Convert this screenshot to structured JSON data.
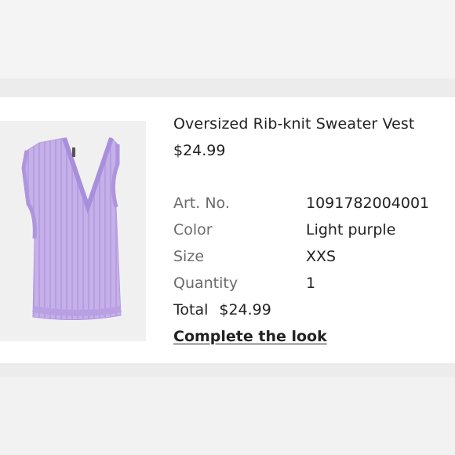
{
  "product": {
    "name": "Oversized Rib-knit Sweater Vest",
    "price": "$24.99",
    "image_icon": "sweater-vest-image",
    "color_swatch": "#c7b2ec"
  },
  "details": [
    {
      "label": "Art. No.",
      "value": "1091782004001"
    },
    {
      "label": "Color",
      "value": "Light purple"
    },
    {
      "label": "Size",
      "value": "XXS"
    },
    {
      "label": "Quantity",
      "value": "1"
    }
  ],
  "total": {
    "label": "Total",
    "value": "$24.99"
  },
  "link": {
    "label": "Complete the look"
  }
}
